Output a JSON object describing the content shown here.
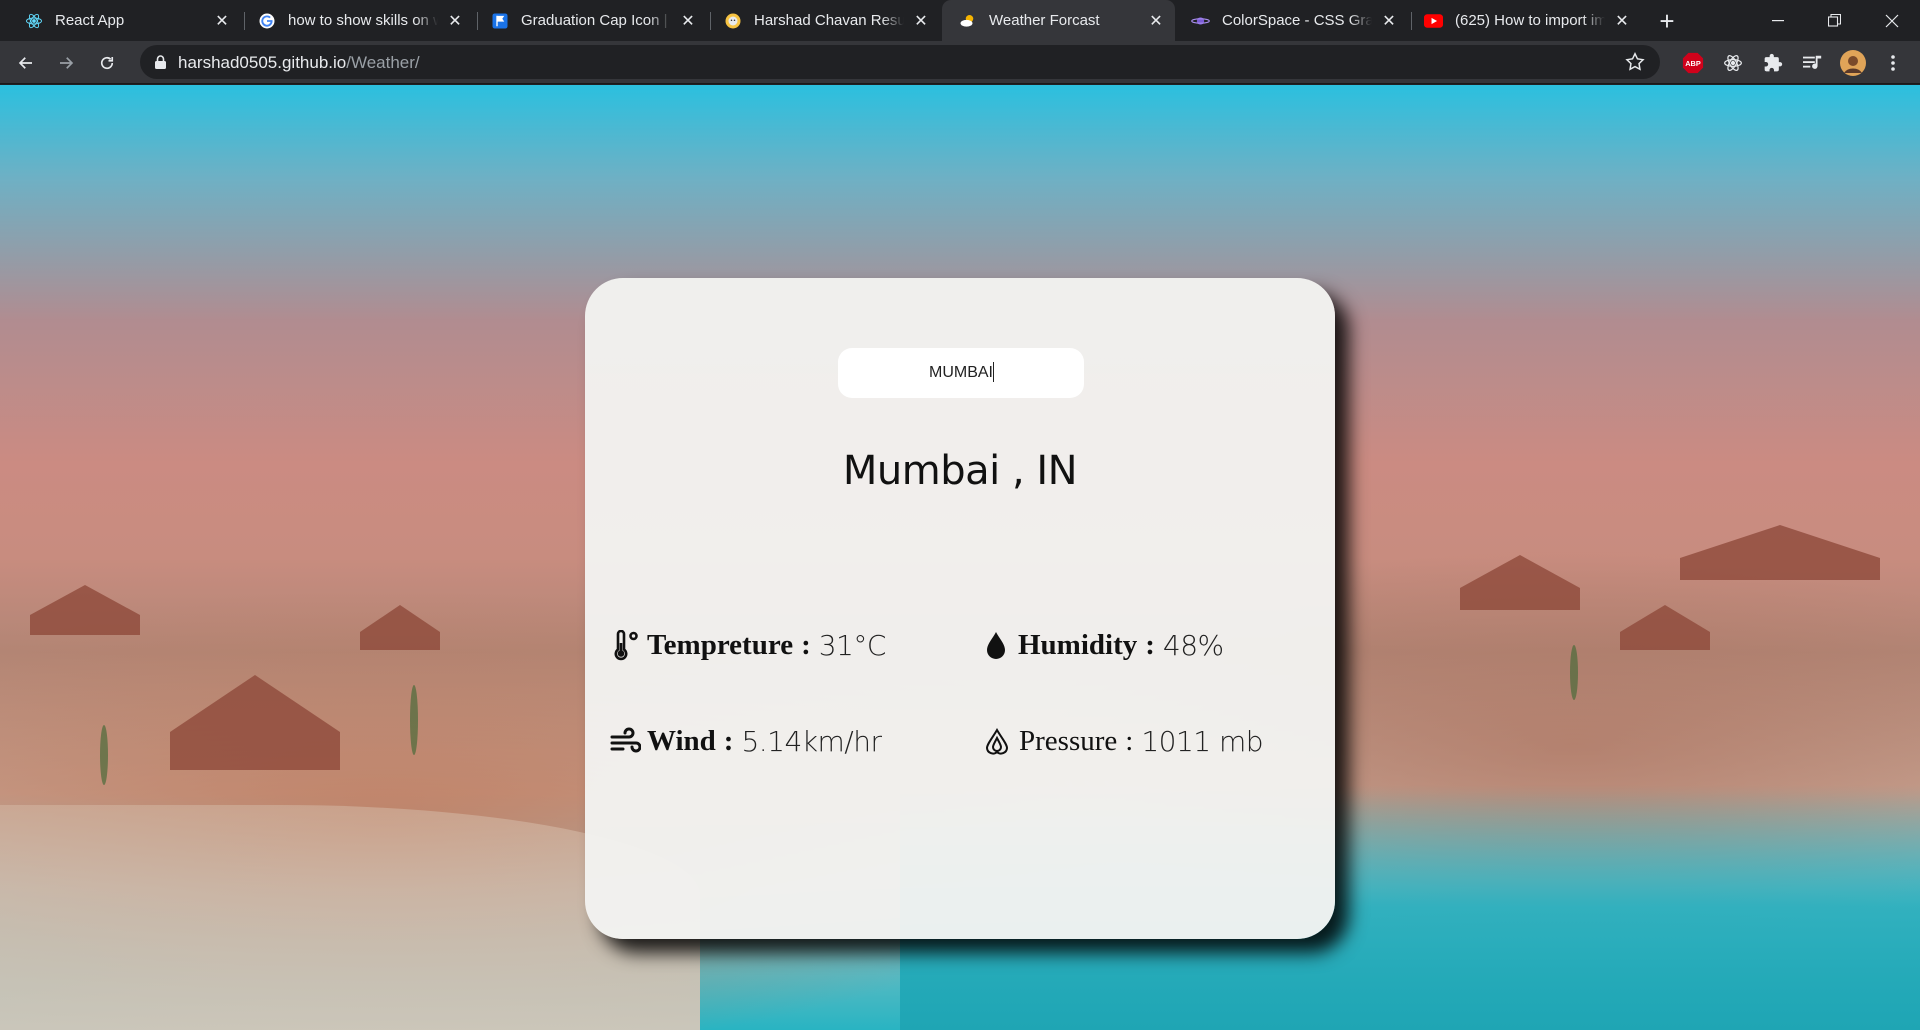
{
  "browser": {
    "tabs": [
      {
        "title": "React App",
        "icon": "react-icon"
      },
      {
        "title": "how to show skills on w",
        "icon": "google-icon"
      },
      {
        "title": "Graduation Cap Icon | F",
        "icon": "flag-icon"
      },
      {
        "title": "Harshad Chavan Resum",
        "icon": "smiley-icon"
      },
      {
        "title": "Weather Forcast",
        "icon": "weather-icon",
        "active": true
      },
      {
        "title": "ColorSpace - CSS Grad",
        "icon": "planet-icon"
      },
      {
        "title": "(625) How to import im",
        "icon": "youtube-icon"
      }
    ],
    "url_host": "harshad0505.github.io",
    "url_path": "/Weather/"
  },
  "weather": {
    "search_value": "MUMBAI",
    "location": "Mumbai , IN",
    "temperature": {
      "label": "Tempreture",
      "separator": ":",
      "value": "31°C"
    },
    "humidity": {
      "label": "Humidity",
      "separator": ":",
      "value": "48%"
    },
    "wind": {
      "label": "Wind",
      "separator": ":",
      "value": "5.14km/hr"
    },
    "pressure": {
      "label": "Pressure",
      "separator": ":",
      "value": "1011 mb"
    }
  },
  "colors": {
    "card_bg": "#f2f2f0",
    "browser_bg": "#202124",
    "toolbar_bg": "#35363a"
  }
}
